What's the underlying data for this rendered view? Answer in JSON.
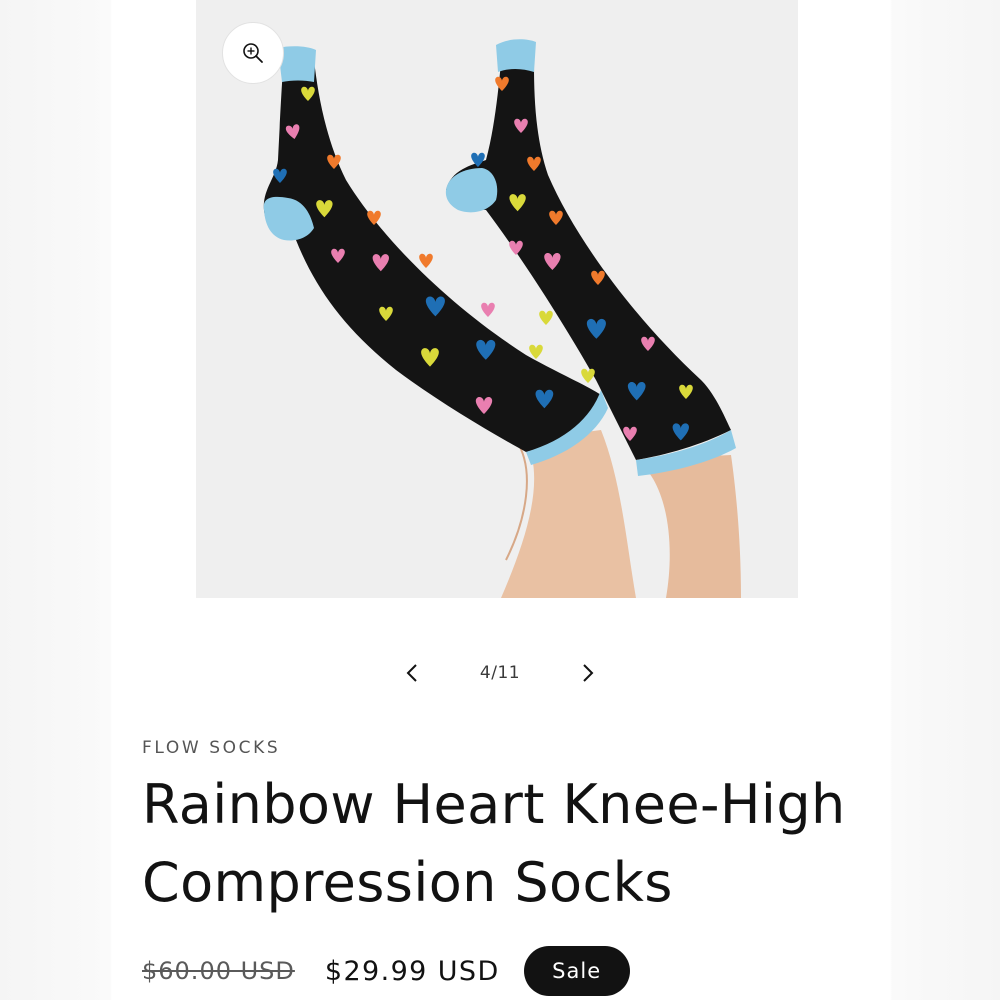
{
  "gallery": {
    "counter": "4/11",
    "image_alt": "Rainbow Heart Knee-High Compression Socks",
    "icons": {
      "zoom": "zoom-in-icon",
      "previous": "chevron-left-icon",
      "next": "chevron-right-icon"
    }
  },
  "product": {
    "vendor": "FLOW SOCKS",
    "title": "Rainbow Heart Knee-High Compression Socks",
    "price_regular": "$60.00 USD",
    "price_sale": "$29.99 USD",
    "badge": "Sale"
  },
  "colors": {
    "sock_body": "#141414",
    "sock_trim": "#8fcbe6",
    "heart_pink": "#e97fb0",
    "heart_orange": "#f07a2c",
    "heart_yellow": "#d9d93a",
    "heart_blue": "#1f6fb5",
    "badge_bg": "#121212"
  }
}
